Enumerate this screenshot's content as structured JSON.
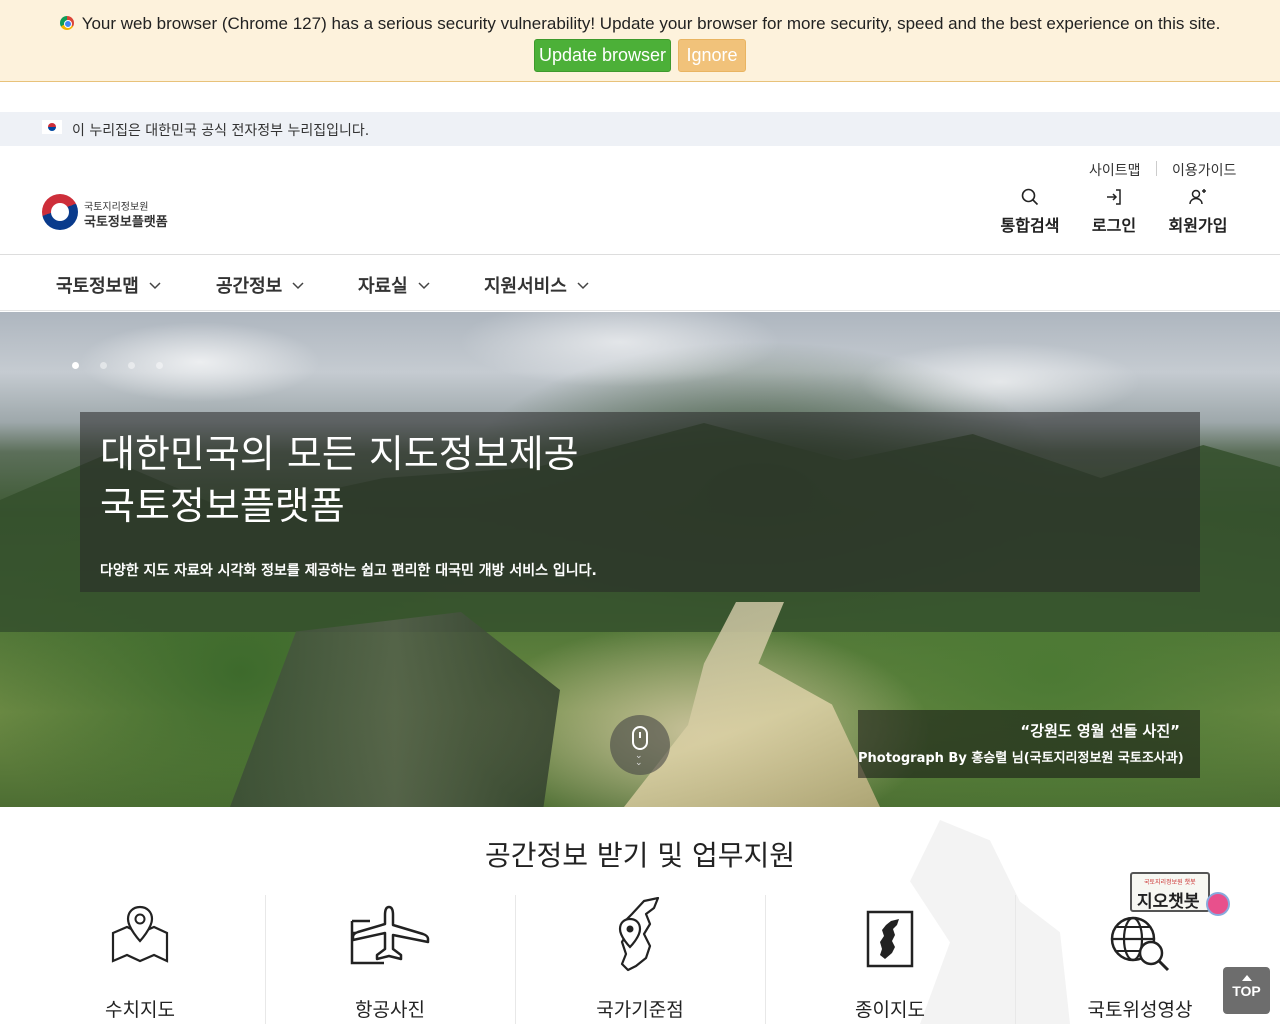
{
  "update_banner": {
    "message": "Your web browser (Chrome 127) has a serious security vulnerability! Update your browser for more security, speed and the best experience on this site.",
    "update_label": "Update browser",
    "ignore_label": "Ignore",
    "update_color": "#4cb038",
    "ignore_color": "#f1c27a",
    "icon": "chrome-icon"
  },
  "gov_banner": {
    "text": "이 누리집은 대한민국 공식 전자정부 누리집입니다.",
    "icon": "korea-flag-icon"
  },
  "header": {
    "logo_sub": "국토지리정보원",
    "logo_main": "국토정보플랫폼",
    "top_links": [
      "사이트맵",
      "이용가이드"
    ],
    "utility": [
      {
        "label": "통합검색",
        "icon": "search-icon"
      },
      {
        "label": "로그인",
        "icon": "login-icon"
      },
      {
        "label": "회원가입",
        "icon": "user-add-icon"
      }
    ]
  },
  "nav": {
    "items": [
      "국토정보맵",
      "공간정보",
      "자료실",
      "지원서비스"
    ]
  },
  "hero": {
    "title_line1": "대한민국의 모든 지도정보제공",
    "title_line2": "국토정보플랫폼",
    "subtitle": "다양한 지도 자료와 시각화 정보를 제공하는 쉽고 편리한 대국민 개방 서비스 입니다.",
    "photo_title": "“강원도 영월 선돌 사진”",
    "photo_credit": "Photograph By 홍승렬 님(국토지리정보원 국토조사과)",
    "slides": 4,
    "active_slide": 1
  },
  "services": {
    "title": "공간정보 받기 및 업무지원",
    "items": [
      {
        "label": "수치지도",
        "icon": "map-pin-icon"
      },
      {
        "label": "항공사진",
        "icon": "airplane-icon"
      },
      {
        "label": "국가기준점",
        "icon": "korea-map-pin-icon"
      },
      {
        "label": "종이지도",
        "icon": "paper-map-icon"
      },
      {
        "label": "국토위성영상",
        "icon": "globe-search-icon"
      }
    ]
  },
  "chatbot": {
    "label": "지오챗봇",
    "caption": "국토지리정보원 챗봇"
  },
  "top_button": {
    "label": "TOP"
  }
}
